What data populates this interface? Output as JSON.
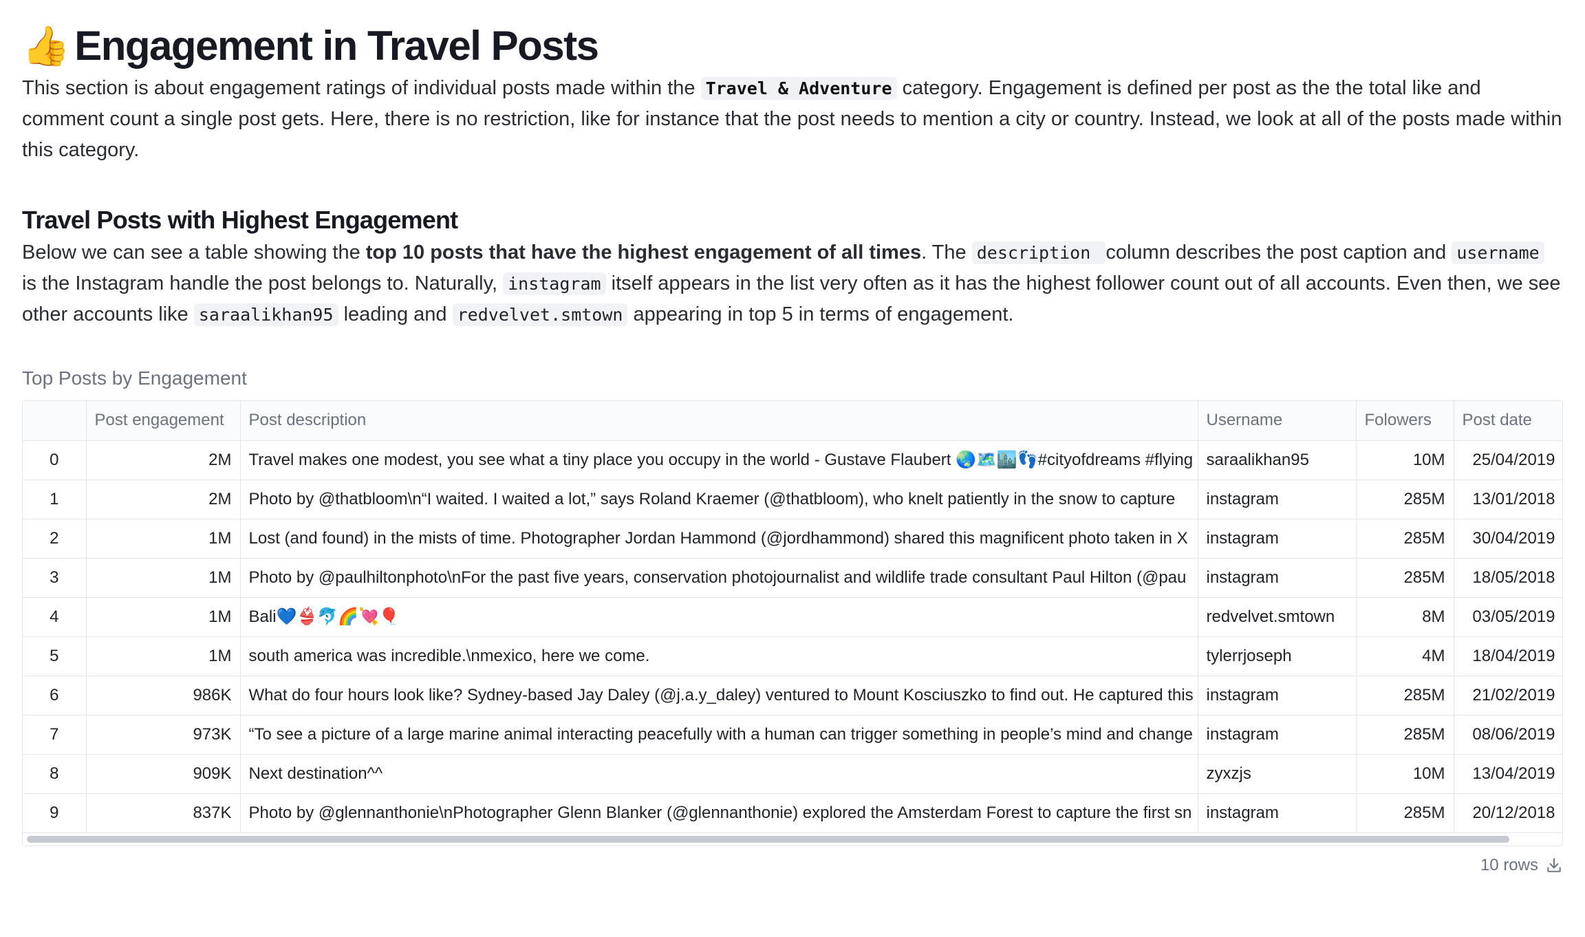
{
  "header": {
    "emoji": "👍",
    "title": "Engagement in Travel Posts"
  },
  "intro": {
    "part1": "This section is about engagement ratings of individual posts made within the ",
    "code": "Travel & Adventure",
    "part2": " category. Engagement is defined per post as the the total like and comment count a single post gets. Here, there is no restriction, like for instance that the post needs to mention a city or country. Instead, we look at all of the posts made within this category."
  },
  "section": {
    "heading": "Travel Posts with Highest Engagement",
    "p1": "Below we can see a table showing the ",
    "bold": "top 10 posts that have the highest engagement of all times",
    "p2": ". The ",
    "code1": "description ",
    "p3": " column describes the post caption and ",
    "code2": "username",
    "p4": " is the Instagram handle the post belongs to. Naturally, ",
    "code3": "instagram",
    "p5": " itself appears in the list very often as it has the highest follower count out of all accounts. Even then, we see other accounts like ",
    "code4": "saraalikhan95",
    "p6": " leading and ",
    "code5": "redvelvet.smtown",
    "p7": " appearing in top 5 in terms of engagement."
  },
  "table": {
    "caption": "Top Posts by Engagement",
    "columns": [
      "",
      "Post engagement",
      "Post description",
      "Username",
      "Folowers",
      "Post date"
    ],
    "rows": [
      {
        "idx": "0",
        "engagement": "2M",
        "description": "Travel makes one modest, you see what a tiny place you occupy in the world - Gustave Flaubert 🌏🗺️🏙️👣#cityofdreams #flying",
        "username": "saraalikhan95",
        "followers": "10M",
        "date": "25/04/2019"
      },
      {
        "idx": "1",
        "engagement": "2M",
        "description": "Photo by @thatbloom\\n“I waited. I waited a lot,” says Roland Kraemer (@thatbloom), who knelt patiently in the snow to capture",
        "username": "instagram",
        "followers": "285M",
        "date": "13/01/2018"
      },
      {
        "idx": "2",
        "engagement": "1M",
        "description": "Lost (and found) in the mists of time. Photographer Jordan Hammond (@jordhammond) shared this magnificent photo taken in X",
        "username": "instagram",
        "followers": "285M",
        "date": "30/04/2019"
      },
      {
        "idx": "3",
        "engagement": "1M",
        "description": "Photo by @paulhiltonphoto\\nFor the past five years, conservation photojournalist and wildlife trade consultant Paul Hilton (@pau",
        "username": "instagram",
        "followers": "285M",
        "date": "18/05/2018"
      },
      {
        "idx": "4",
        "engagement": "1M",
        "description": "Bali💙👙🐬🌈💘🎈",
        "username": "redvelvet.smtown",
        "followers": "8M",
        "date": "03/05/2019"
      },
      {
        "idx": "5",
        "engagement": "1M",
        "description": "south america was incredible.\\nmexico, here we come.",
        "username": "tylerrjoseph",
        "followers": "4M",
        "date": "18/04/2019"
      },
      {
        "idx": "6",
        "engagement": "986K",
        "description": "What do four hours look like? Sydney-based Jay Daley (@j.a.y_daley) ventured to Mount Kosciuszko to find out. He captured this",
        "username": "instagram",
        "followers": "285M",
        "date": "21/02/2019"
      },
      {
        "idx": "7",
        "engagement": "973K",
        "description": "“To see a picture of a large marine animal interacting peacefully with a human can trigger something in people’s mind and change",
        "username": "instagram",
        "followers": "285M",
        "date": "08/06/2019"
      },
      {
        "idx": "8",
        "engagement": "909K",
        "description": "Next destination^^",
        "username": "zyxzjs",
        "followers": "10M",
        "date": "13/04/2019"
      },
      {
        "idx": "9",
        "engagement": "837K",
        "description": "Photo by @glennanthonie\\nPhotographer Glenn Blanker (@glennanthonie) explored the Amsterdam Forest to capture the first sn",
        "username": "instagram",
        "followers": "285M",
        "date": "20/12/2018"
      }
    ],
    "footer_count": "10 rows",
    "download_icon": "download-icon"
  }
}
